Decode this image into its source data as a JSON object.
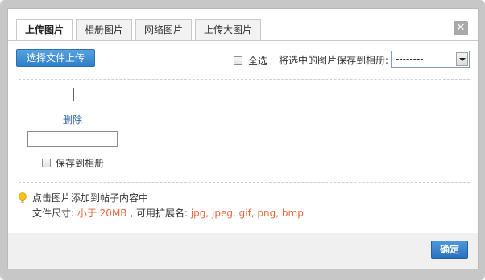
{
  "tabs": [
    {
      "label": "上传图片",
      "active": true
    },
    {
      "label": "相册图片",
      "active": false
    },
    {
      "label": "网络图片",
      "active": false
    },
    {
      "label": "上传大图片",
      "active": false
    }
  ],
  "close_icon": "close-icon",
  "toolbar": {
    "upload_button": "选择文件上传",
    "select_all_label": "全选",
    "save_to_album_label": "将选中的图片保存到相册:",
    "album_select_value": "--------"
  },
  "image_item": {
    "delete_link": "删除",
    "caption_value": "",
    "save_to_album_label": "保存到相册"
  },
  "tips": {
    "icon": "lightbulb-icon",
    "line1": "点击图片添加到帖子内容中",
    "size_prefix": "文件尺寸: ",
    "size_value": "小于 20MB",
    "ext_prefix": " , 可用扩展名: ",
    "ext_value": "jpg, jpeg, gif, png, bmp"
  },
  "footer": {
    "confirm_button": "确定"
  },
  "colors": {
    "accent_blue": "#2f7ec9",
    "highlight_orange": "#e5663d",
    "link_blue": "#2b63a5"
  }
}
